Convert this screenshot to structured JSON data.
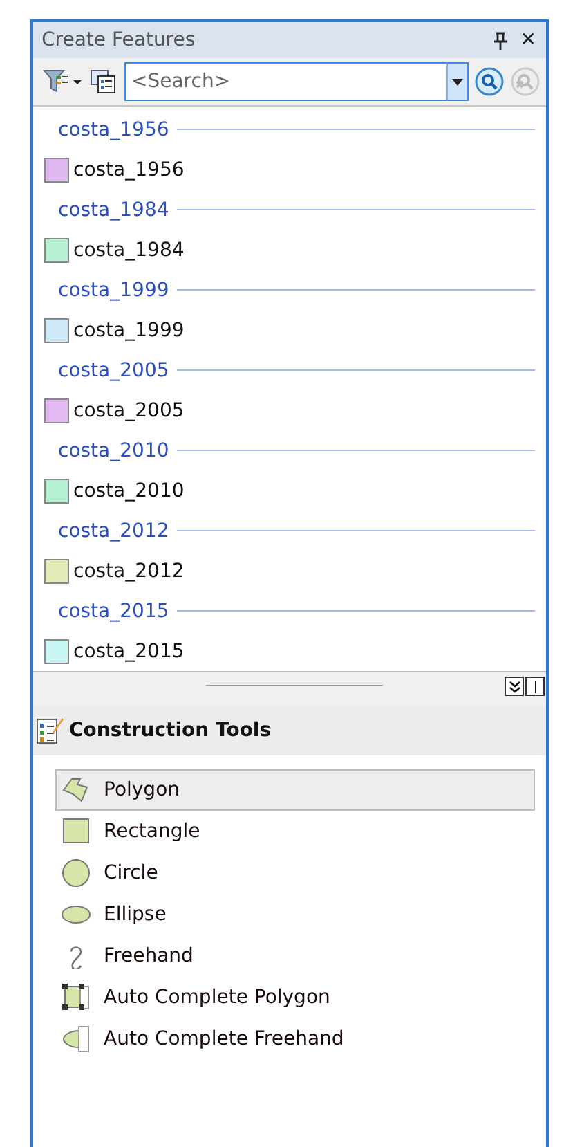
{
  "panel": {
    "title": "Create Features",
    "close": "✕"
  },
  "search": {
    "placeholder": "<Search>"
  },
  "templates": [
    {
      "group": "costa_1956",
      "name": "costa_1956",
      "color": "#e0b8f0"
    },
    {
      "group": "costa_1984",
      "name": "costa_1984",
      "color": "#b8f0d4"
    },
    {
      "group": "costa_1999",
      "name": "costa_1999",
      "color": "#cfe8f6"
    },
    {
      "group": "costa_2005",
      "name": "costa_2005",
      "color": "#e4b8f2"
    },
    {
      "group": "costa_2010",
      "name": "costa_2010",
      "color": "#b4f0d2"
    },
    {
      "group": "costa_2012",
      "name": "costa_2012",
      "color": "#e2ecb8"
    },
    {
      "group": "costa_2015",
      "name": "costa_2015",
      "color": "#c8f6f4"
    }
  ],
  "construction_tools": {
    "title": "Construction Tools",
    "tools": [
      {
        "label": "Polygon",
        "kind": "polygon",
        "selected": true
      },
      {
        "label": "Rectangle",
        "kind": "rectangle",
        "selected": false
      },
      {
        "label": "Circle",
        "kind": "circle",
        "selected": false
      },
      {
        "label": "Ellipse",
        "kind": "ellipse",
        "selected": false
      },
      {
        "label": "Freehand",
        "kind": "freehand",
        "selected": false
      },
      {
        "label": "Auto Complete Polygon",
        "kind": "autopolygon",
        "selected": false
      },
      {
        "label": "Auto Complete Freehand",
        "kind": "autofreehand",
        "selected": false
      }
    ]
  }
}
